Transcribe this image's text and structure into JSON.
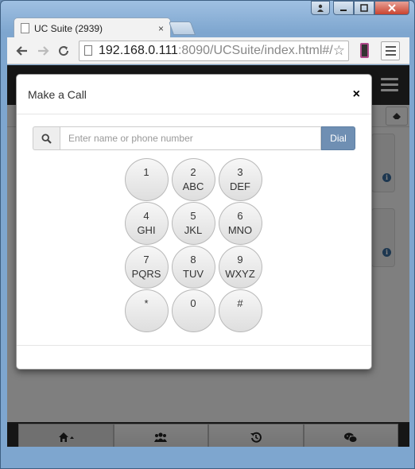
{
  "browser": {
    "tab_title": "UC Suite (2939)",
    "tab_close": "×",
    "url_host": "192.168.0.111",
    "url_rest": ":8090/UCSuite/index.html#/"
  },
  "modal": {
    "title": "Make a Call",
    "close_label": "×",
    "search_placeholder": "Enter name or phone number",
    "dial_label": "Dial",
    "keys": [
      {
        "digit": "1",
        "letters": ""
      },
      {
        "digit": "2",
        "letters": "ABC"
      },
      {
        "digit": "3",
        "letters": "DEF"
      },
      {
        "digit": "4",
        "letters": "GHI"
      },
      {
        "digit": "5",
        "letters": "JKL"
      },
      {
        "digit": "6",
        "letters": "MNO"
      },
      {
        "digit": "7",
        "letters": "PQRS"
      },
      {
        "digit": "8",
        "letters": "TUV"
      },
      {
        "digit": "9",
        "letters": "WXYZ"
      },
      {
        "digit": "*",
        "letters": ""
      },
      {
        "digit": "0",
        "letters": ""
      },
      {
        "digit": "#",
        "letters": ""
      }
    ]
  },
  "bottom_nav": [
    {
      "icon": "home-icon",
      "active": true
    },
    {
      "icon": "users-icon",
      "active": false
    },
    {
      "icon": "history-icon",
      "active": false
    },
    {
      "icon": "chat-icon",
      "active": false
    }
  ],
  "colors": {
    "dial_button": "#6f8fb3",
    "app_header": "#2c2c2c",
    "info_icon": "#3a6fa0"
  }
}
